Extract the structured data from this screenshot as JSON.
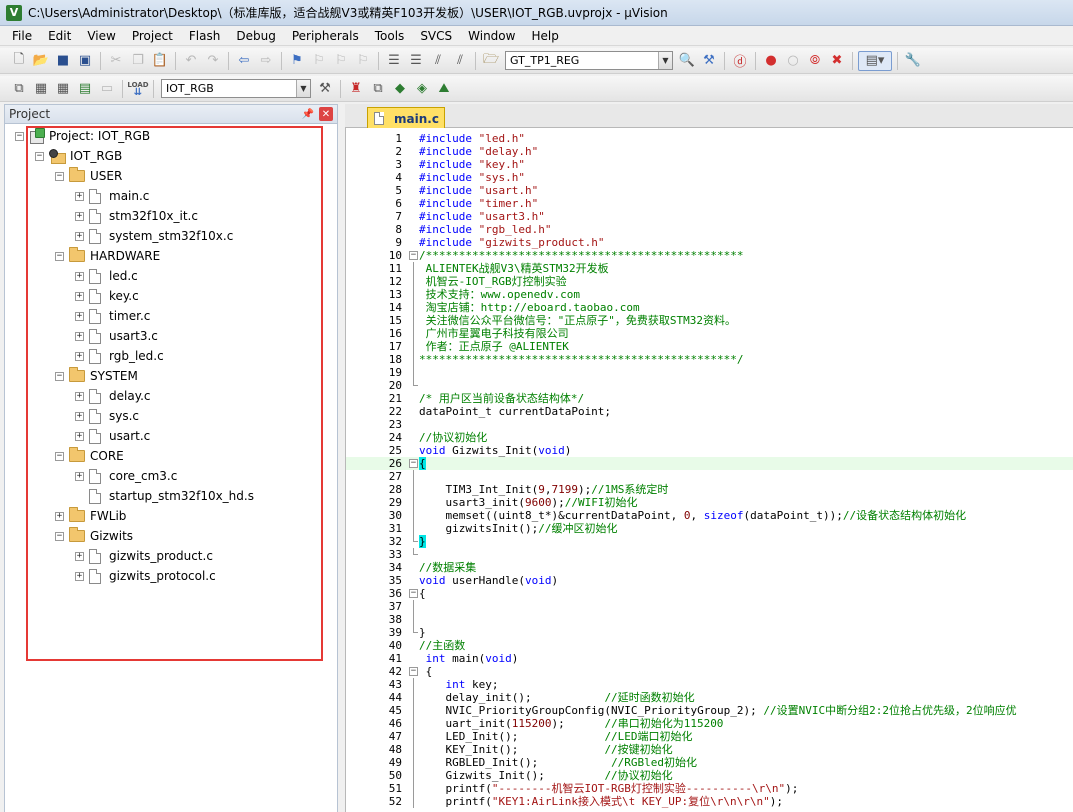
{
  "window": {
    "title": "C:\\Users\\Administrator\\Desktop\\（标准库版，适合战舰V3或精英F103开发板）\\USER\\IOT_RGB.uvprojx - µVision",
    "app_icon": "V"
  },
  "menu": [
    "File",
    "Edit",
    "View",
    "Project",
    "Flash",
    "Debug",
    "Peripherals",
    "Tools",
    "SVCS",
    "Window",
    "Help"
  ],
  "toolbar1": {
    "find_select": "GT_TP1_REG"
  },
  "toolbar2": {
    "target_select": "IOT_RGB",
    "load_label": "LOAD"
  },
  "project_panel": {
    "title": "Project",
    "tree": [
      {
        "label": "Project: IOT_RGB",
        "level": 0,
        "kind": "project",
        "exp": "−"
      },
      {
        "label": "IOT_RGB",
        "level": 1,
        "kind": "target",
        "exp": "−"
      },
      {
        "label": "USER",
        "level": 2,
        "kind": "folder",
        "exp": "−"
      },
      {
        "label": "main.c",
        "level": 3,
        "kind": "file",
        "exp": "+"
      },
      {
        "label": "stm32f10x_it.c",
        "level": 3,
        "kind": "file",
        "exp": "+"
      },
      {
        "label": "system_stm32f10x.c",
        "level": 3,
        "kind": "file",
        "exp": "+"
      },
      {
        "label": "HARDWARE",
        "level": 2,
        "kind": "folder",
        "exp": "−"
      },
      {
        "label": "led.c",
        "level": 3,
        "kind": "file",
        "exp": "+"
      },
      {
        "label": "key.c",
        "level": 3,
        "kind": "file",
        "exp": "+"
      },
      {
        "label": "timer.c",
        "level": 3,
        "kind": "file",
        "exp": "+"
      },
      {
        "label": "usart3.c",
        "level": 3,
        "kind": "file",
        "exp": "+"
      },
      {
        "label": "rgb_led.c",
        "level": 3,
        "kind": "file",
        "exp": "+"
      },
      {
        "label": "SYSTEM",
        "level": 2,
        "kind": "folder",
        "exp": "−"
      },
      {
        "label": "delay.c",
        "level": 3,
        "kind": "file",
        "exp": "+"
      },
      {
        "label": "sys.c",
        "level": 3,
        "kind": "file",
        "exp": "+"
      },
      {
        "label": "usart.c",
        "level": 3,
        "kind": "file",
        "exp": "+"
      },
      {
        "label": "CORE",
        "level": 2,
        "kind": "folder",
        "exp": "−"
      },
      {
        "label": "core_cm3.c",
        "level": 3,
        "kind": "file",
        "exp": "+"
      },
      {
        "label": "startup_stm32f10x_hd.s",
        "level": 3,
        "kind": "file",
        "exp": ""
      },
      {
        "label": "FWLib",
        "level": 2,
        "kind": "folder",
        "exp": "+"
      },
      {
        "label": "Gizwits",
        "level": 2,
        "kind": "folder",
        "exp": "−"
      },
      {
        "label": "gizwits_product.c",
        "level": 3,
        "kind": "file",
        "exp": "+"
      },
      {
        "label": "gizwits_protocol.c",
        "level": 3,
        "kind": "file",
        "exp": "+"
      }
    ]
  },
  "editor": {
    "active_tab": "main.c",
    "current_line": 26,
    "lines": [
      {
        "n": 1,
        "t": "#include \"led.h\""
      },
      {
        "n": 2,
        "t": "#include \"delay.h\""
      },
      {
        "n": 3,
        "t": "#include \"key.h\""
      },
      {
        "n": 4,
        "t": "#include \"sys.h\""
      },
      {
        "n": 5,
        "t": "#include \"usart.h\""
      },
      {
        "n": 6,
        "t": "#include \"timer.h\""
      },
      {
        "n": 7,
        "t": "#include \"usart3.h\""
      },
      {
        "n": 8,
        "t": "#include \"rgb_led.h\""
      },
      {
        "n": 9,
        "t": "#include \"gizwits_product.h\""
      },
      {
        "n": 10,
        "t": "/************************************************",
        "fold": "box"
      },
      {
        "n": 11,
        "t": " ALIENTEK战舰V3\\精英STM32开发板",
        "fold": "line"
      },
      {
        "n": 12,
        "t": " 机智云-IOT_RGB灯控制实验",
        "fold": "line"
      },
      {
        "n": 13,
        "t": " 技术支持：www.openedv.com",
        "fold": "line"
      },
      {
        "n": 14,
        "t": " 淘宝店铺：http://eboard.taobao.com",
        "fold": "line"
      },
      {
        "n": 15,
        "t": " 关注微信公众平台微信号：\"正点原子\"，免费获取STM32资料。",
        "fold": "line"
      },
      {
        "n": 16,
        "t": " 广州市星翼电子科技有限公司",
        "fold": "line"
      },
      {
        "n": 17,
        "t": " 作者：正点原子 @ALIENTEK",
        "fold": "line"
      },
      {
        "n": 18,
        "t": "************************************************/",
        "fold": "line"
      },
      {
        "n": 19,
        "t": "",
        "fold": "line"
      },
      {
        "n": 20,
        "t": "",
        "fold": "end"
      },
      {
        "n": 21,
        "t": "/* 用户区当前设备状态结构体*/"
      },
      {
        "n": 22,
        "t": "dataPoint_t currentDataPoint;"
      },
      {
        "n": 23,
        "t": ""
      },
      {
        "n": 24,
        "t": "//协议初始化"
      },
      {
        "n": 25,
        "t": "void Gizwits_Init(void)"
      },
      {
        "n": 26,
        "t": "{",
        "fold": "box"
      },
      {
        "n": 27,
        "t": "",
        "fold": "line"
      },
      {
        "n": 28,
        "t": "    TIM3_Int_Init(9,7199);//1MS系统定时",
        "fold": "line"
      },
      {
        "n": 29,
        "t": "    usart3_init(9600);//WIFI初始化",
        "fold": "line"
      },
      {
        "n": 30,
        "t": "    memset((uint8_t*)&currentDataPoint, 0, sizeof(dataPoint_t));//设备状态结构体初始化",
        "fold": "line"
      },
      {
        "n": 31,
        "t": "    gizwitsInit();//缓冲区初始化",
        "fold": "line"
      },
      {
        "n": 32,
        "t": "}",
        "fold": "end"
      },
      {
        "n": 33,
        "t": "",
        "fold": "end"
      },
      {
        "n": 34,
        "t": "//数据采集"
      },
      {
        "n": 35,
        "t": "void userHandle(void)"
      },
      {
        "n": 36,
        "t": "{",
        "fold": "box"
      },
      {
        "n": 37,
        "t": "",
        "fold": "line"
      },
      {
        "n": 38,
        "t": "",
        "fold": "line"
      },
      {
        "n": 39,
        "t": "}",
        "fold": "end"
      },
      {
        "n": 40,
        "t": "//主函数"
      },
      {
        "n": 41,
        "t": " int main(void)"
      },
      {
        "n": 42,
        "t": " {",
        "fold": "box"
      },
      {
        "n": 43,
        "t": "    int key;",
        "fold": "line"
      },
      {
        "n": 44,
        "t": "    delay_init();           //延时函数初始化",
        "fold": "line"
      },
      {
        "n": 45,
        "t": "    NVIC_PriorityGroupConfig(NVIC_PriorityGroup_2); //设置NVIC中断分组2:2位抢占优先级，2位响应优",
        "fold": "line"
      },
      {
        "n": 46,
        "t": "    uart_init(115200);      //串口初始化为115200",
        "fold": "line"
      },
      {
        "n": 47,
        "t": "    LED_Init();             //LED端口初始化",
        "fold": "line"
      },
      {
        "n": 48,
        "t": "    KEY_Init();             //按键初始化",
        "fold": "line"
      },
      {
        "n": 49,
        "t": "    RGBLED_Init();           //RGBled初始化",
        "fold": "line"
      },
      {
        "n": 50,
        "t": "    Gizwits_Init();         //协议初始化",
        "fold": "line"
      },
      {
        "n": 51,
        "t": "    printf(\"--------机智云IOT-RGB灯控制实验----------\\r\\n\");",
        "fold": "line"
      },
      {
        "n": 52,
        "t": "    printf(\"KEY1:AirLink接入模式\\t KEY_UP:复位\\r\\n\\r\\n\");",
        "fold": "line"
      }
    ]
  }
}
